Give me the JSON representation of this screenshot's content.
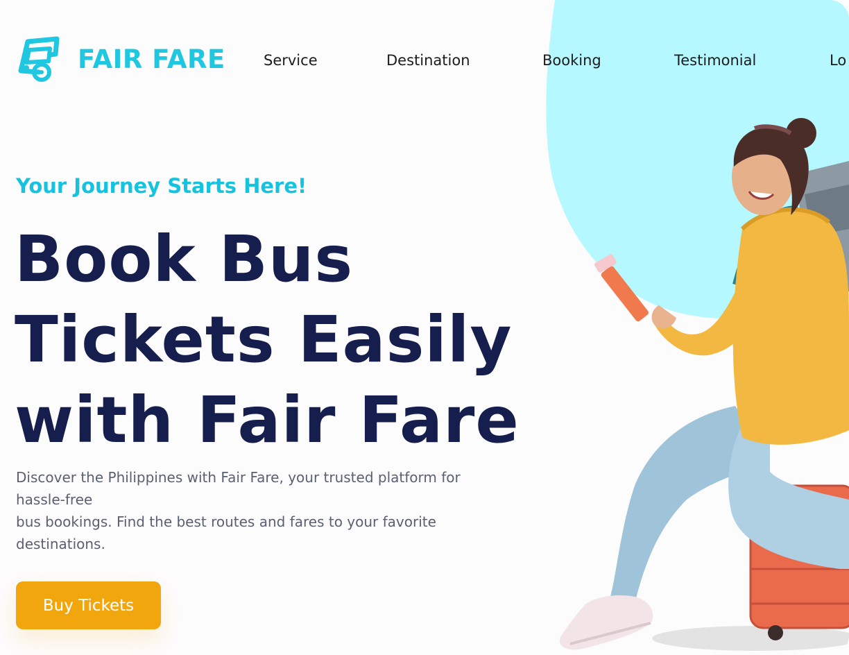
{
  "brand": {
    "name": "FAIR FARE",
    "icon": "bus-icon",
    "color": "#1fc7e0"
  },
  "nav": {
    "items": [
      {
        "label": "Service"
      },
      {
        "label": "Destination"
      },
      {
        "label": "Booking"
      },
      {
        "label": "Testimonial"
      },
      {
        "label": "Lo"
      }
    ]
  },
  "hero": {
    "tagline": "Your Journey Starts Here!",
    "headline": [
      "Book Bus",
      "Tickets Easily",
      "with Fair Fare"
    ],
    "description": [
      "Discover the Philippines with Fair Fare, your trusted platform for",
      "hassle-free",
      "bus bookings. Find the best routes and fares to your favorite",
      "destinations."
    ],
    "cta_label": "Buy Tickets",
    "image": "traveler-with-backpack-sitting-on-suitcase"
  },
  "colors": {
    "accent": "#1fc7e0",
    "headline": "#151e4d",
    "cta": "#f2a60e",
    "blob": "#b5f8ff"
  }
}
